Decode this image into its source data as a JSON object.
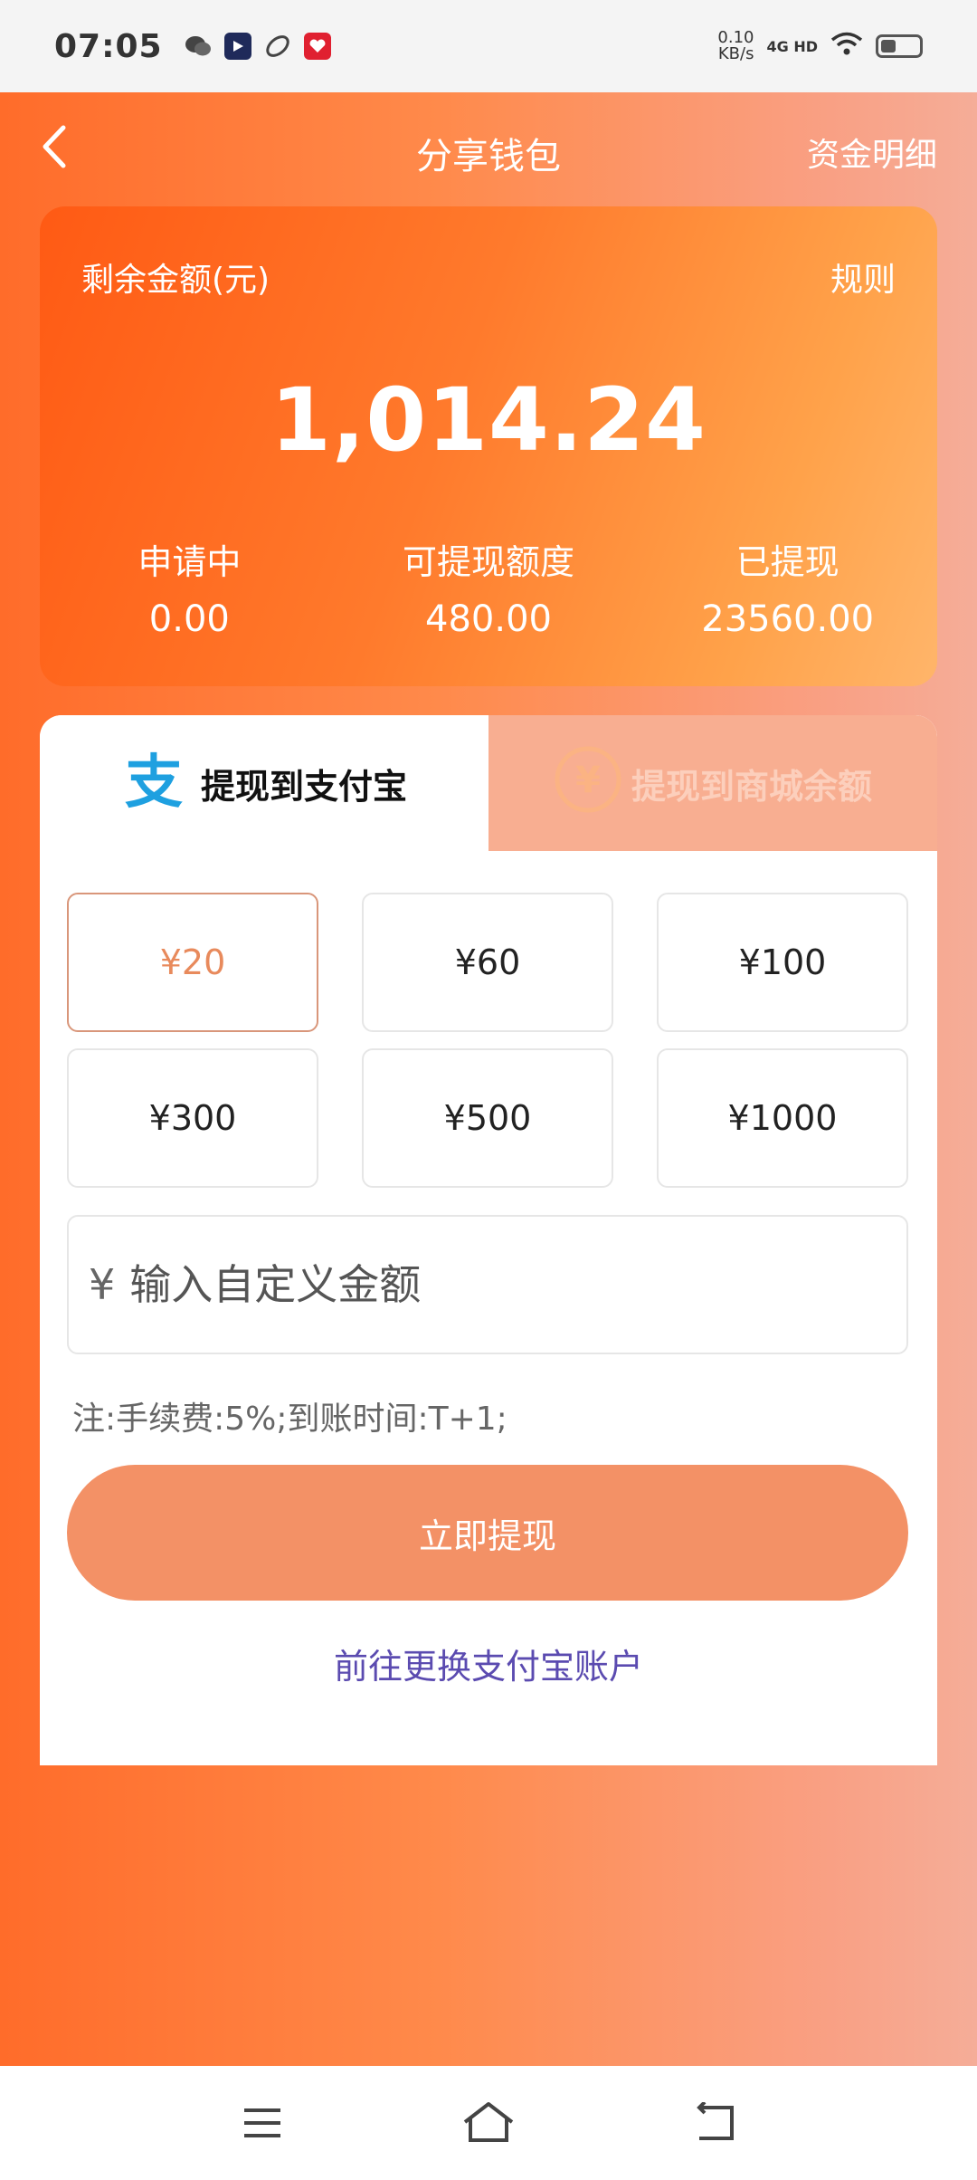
{
  "status_bar": {
    "time": "07:05",
    "net_speed_value": "0.10",
    "net_speed_unit": "KB/s",
    "network": "4G HD",
    "icons": [
      "wechat-icon",
      "video-app-icon",
      "leaf-app-icon",
      "red-app-icon",
      "wifi-icon",
      "battery-icon"
    ]
  },
  "header": {
    "title": "分享钱包",
    "funds_link": "资金明细"
  },
  "balance_card": {
    "remaining_label": "剩余金额(元)",
    "rules_link": "规则",
    "amount": "1,014.24",
    "stats": [
      {
        "label": "申请中",
        "value": "0.00"
      },
      {
        "label": "可提现额度",
        "value": "480.00"
      },
      {
        "label": "已提现",
        "value": "23560.00"
      }
    ]
  },
  "tabs": [
    {
      "label": "提现到支付宝",
      "active": true,
      "icon": "alipay-icon"
    },
    {
      "label": "提现到商城余额",
      "active": false,
      "icon": "yen-coin-icon"
    }
  ],
  "amount_options": [
    "¥20",
    "¥60",
    "¥100",
    "¥300",
    "¥500",
    "¥1000"
  ],
  "selected_amount": "¥20",
  "custom_amount": {
    "prefix": "¥",
    "placeholder": "输入自定义金额"
  },
  "fee_note": "注:手续费:5%;到账时间:T+1;",
  "withdraw_button": "立即提现",
  "change_account_link": "前往更换支付宝账户",
  "colors": {
    "accent": "#f39166",
    "gradient_start": "#ff6c2a",
    "gradient_end": "#f5ad98",
    "link": "#5b4bb0"
  }
}
